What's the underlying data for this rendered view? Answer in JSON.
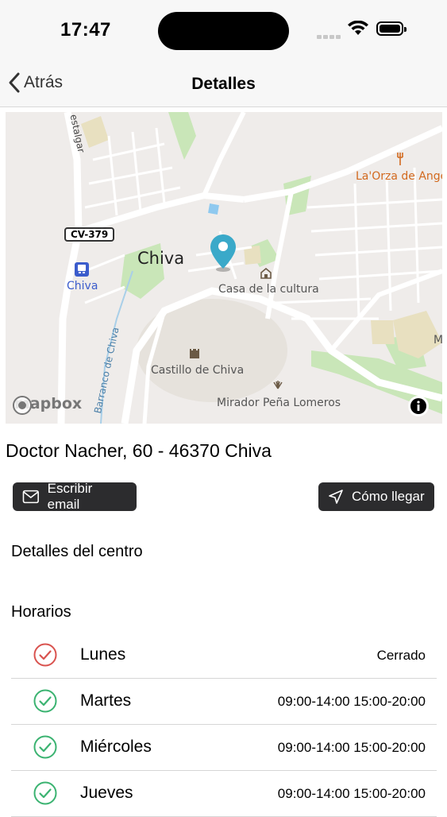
{
  "status_bar": {
    "time": "17:47"
  },
  "nav": {
    "back_label": "Atrás",
    "title": "Detalles"
  },
  "map": {
    "labels": {
      "town": "Chiva",
      "station": "Chiva",
      "road": "CV-379",
      "street_top": "estalgar",
      "ravine": "Barranco de Chiva",
      "culture_house": "Casa de la cultura",
      "castle": "Castillo de Chiva",
      "viewpoint": "Mirador Peña Lomeros",
      "restaurant": "La'Orza de Ange",
      "edge_letter": "M",
      "attribution": "mapbox"
    }
  },
  "address": "Doctor Nacher, 60 - 46370 Chiva",
  "actions": {
    "email_label": "Escribir email",
    "directions_label": "Cómo llegar"
  },
  "sections": {
    "center_details": "Detalles del centro",
    "schedule": "Horarios"
  },
  "schedule": [
    {
      "day": "Lunes",
      "hours": "Cerrado",
      "status": "closed"
    },
    {
      "day": "Martes",
      "hours": "09:00-14:00 15:00-20:00",
      "status": "open"
    },
    {
      "day": "Miércoles",
      "hours": "09:00-14:00 15:00-20:00",
      "status": "open"
    },
    {
      "day": "Jueves",
      "hours": "09:00-14:00 15:00-20:00",
      "status": "open"
    }
  ],
  "colors": {
    "closed": "#d9534f",
    "open": "#3bb371",
    "pin": "#3aa9c9",
    "button_bg": "#2c2c2e"
  }
}
